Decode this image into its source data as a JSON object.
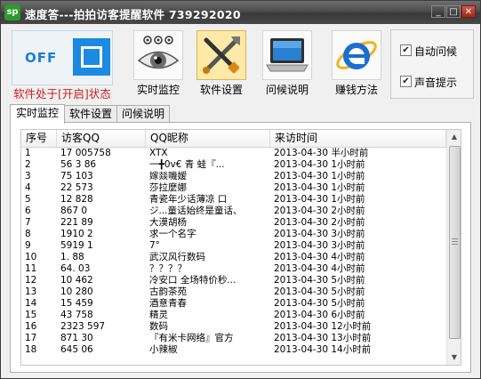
{
  "window": {
    "title": "速度答---拍拍访客提醒软件  739292020",
    "app_icon_text": "sp",
    "buttons": {
      "minimize": "_",
      "maximize": "□",
      "close": "✕"
    }
  },
  "toggle": {
    "state_text": "OFF",
    "status": "软件处于[开启]状态"
  },
  "toolbar": [
    {
      "label": "实时监控",
      "icon": "eye-icon"
    },
    {
      "label": "软件设置",
      "icon": "tools-icon",
      "active": true
    },
    {
      "label": "问候说明",
      "icon": "laptop-icon"
    },
    {
      "label": "赚钱方法",
      "icon": "ie-icon"
    }
  ],
  "options": [
    {
      "label": "自动问候",
      "checked": true
    },
    {
      "label": "声音提示",
      "checked": true
    }
  ],
  "tabs": [
    {
      "label": "实时监控",
      "active": true
    },
    {
      "label": "软件设置",
      "active": false
    },
    {
      "label": "问候说明",
      "active": false
    }
  ],
  "table": {
    "columns": [
      "序号",
      "访客QQ",
      "QQ昵称",
      "来访时间"
    ],
    "rows": [
      [
        "1",
        "17  005758",
        "XTX",
        "2013-04-30 半小时前"
      ],
      [
        "2",
        "56  3  86",
        "一╋0v€ 青  蛙『...",
        "2013-04-30 1小时前"
      ],
      [
        "3",
        "75    103",
        "嫁燚嘰嫒",
        "2013-04-30 1小时前"
      ],
      [
        "4",
        "22    573",
        "莎拉麼娜",
        "2013-04-30 1小时前"
      ],
      [
        "5",
        "12    828",
        "青瓷年少话薄凉 口",
        "2013-04-30 1小时前"
      ],
      [
        "6",
        "867   0",
        "ジ...童话始终是童话、",
        "2013-04-30 2小时前"
      ],
      [
        "7",
        "221   89",
        "大漠胡杨",
        "2013-04-30 2小时前"
      ],
      [
        "8",
        "1910  2",
        "求一个名字",
        "2013-04-30 3小时前"
      ],
      [
        "9",
        "5919  1",
        "7°",
        "2013-04-30 3小时前"
      ],
      [
        "10",
        "1.    88",
        "武汉风行数码",
        "2013-04-30 4小时前"
      ],
      [
        "11",
        "64.    03",
        "？？？？",
        "2013-04-30 4小时前"
      ],
      [
        "12",
        "10    462",
        "冷安口 全场特价秒...",
        "2013-04-30 5小时前"
      ],
      [
        "13",
        "10    280",
        "古韵茶苑",
        "2013-04-30 5小时前"
      ],
      [
        "14",
        "15    459",
        "酒意青春",
        "2013-04-30 5小时前"
      ],
      [
        "15",
        "43    758",
        "精灵",
        "2013-04-30 6小时前"
      ],
      [
        "16",
        "2323    597",
        "数码",
        "2013-04-30 12小时前"
      ],
      [
        "17",
        "871    30",
        "『有米卡网络』官方",
        "2013-04-30 13小时前"
      ],
      [
        "18",
        "645    06",
        "小辣椒",
        "2013-04-30 14小时前"
      ]
    ]
  },
  "scrollbar": {
    "up": "▲",
    "down": "▼"
  },
  "colors": {
    "status_red": "#d11c1c",
    "accent_blue": "#1b8ae0",
    "active_tool": "#ffe9a8"
  }
}
